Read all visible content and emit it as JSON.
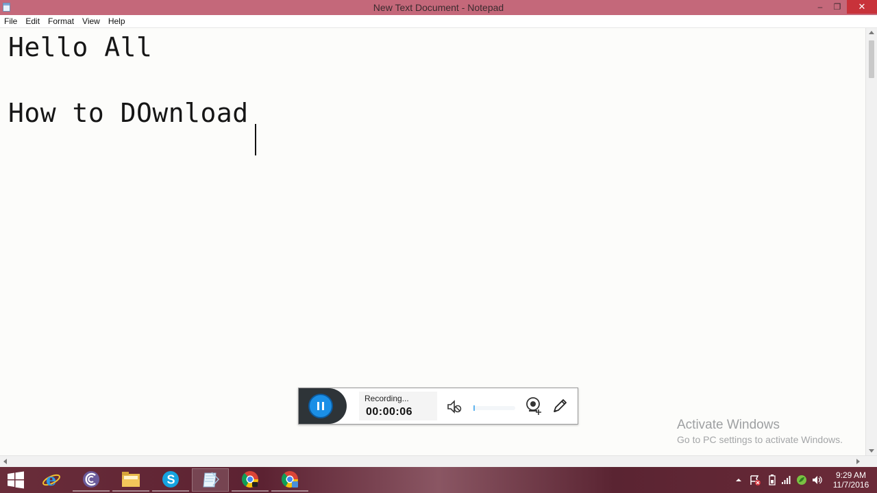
{
  "window": {
    "title": "New Text Document - Notepad",
    "controls": {
      "minimize": "–",
      "maximize": "❐",
      "close": "✕"
    }
  },
  "menubar": {
    "items": [
      "File",
      "Edit",
      "Format",
      "View",
      "Help"
    ]
  },
  "editor": {
    "lines": [
      "Hello All",
      "How to DOwnload "
    ]
  },
  "recorder": {
    "status": "Recording...",
    "time": "00:00:06",
    "accent": "#1b8fe6"
  },
  "watermark": {
    "title": "Activate Windows",
    "subtitle": "Go to PC settings to activate Windows."
  },
  "taskbar": {
    "apps": [
      {
        "icon": "internet-explorer-icon"
      },
      {
        "icon": "bittorrent-icon"
      },
      {
        "icon": "file-explorer-icon"
      },
      {
        "icon": "skype-icon"
      },
      {
        "icon": "notepad-icon"
      },
      {
        "icon": "chrome-icon"
      },
      {
        "icon": "chrome-icon"
      }
    ],
    "clock": {
      "time": "9:29 AM",
      "date": "11/7/2016"
    }
  }
}
